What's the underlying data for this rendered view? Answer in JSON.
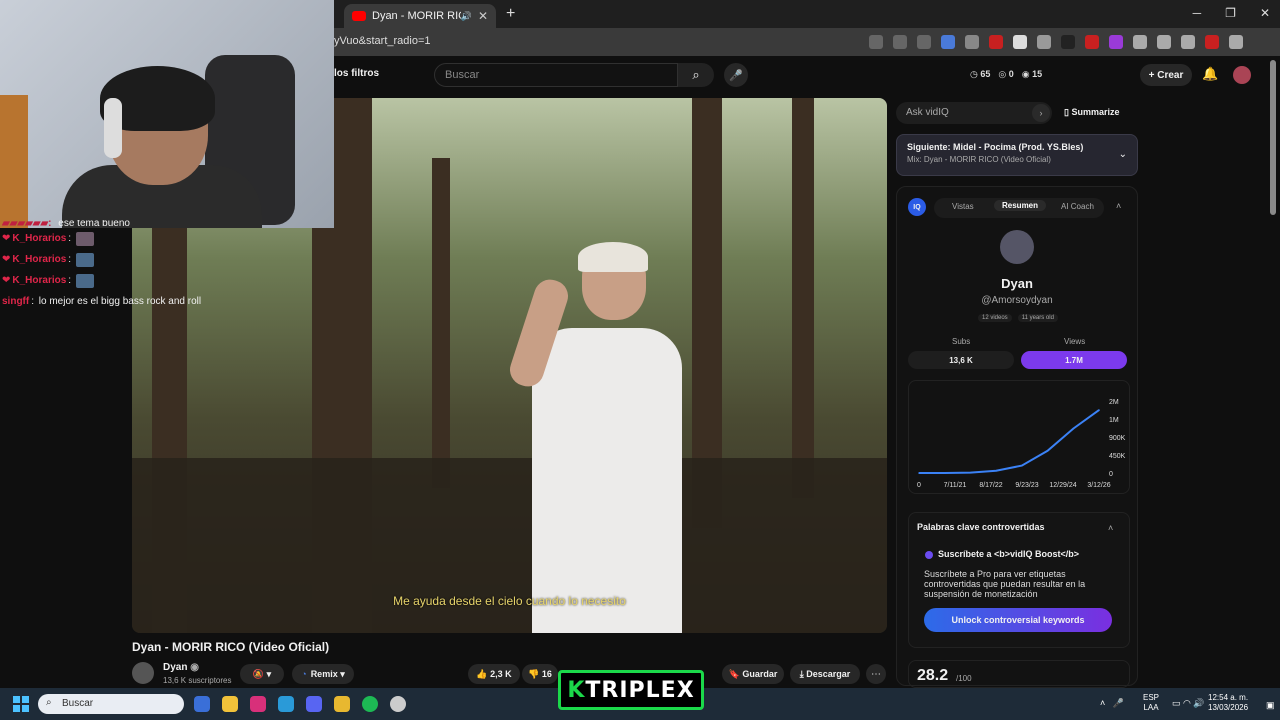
{
  "browser": {
    "tab_title": "Dyan - MORIR RICO (Vide",
    "url_fragment": "yVuo&start_radio=1"
  },
  "header": {
    "filters_label": "los filtros",
    "search_placeholder": "Buscar",
    "stat1": "65",
    "stat2": "0",
    "stat3": "15",
    "create_label": "Crear"
  },
  "chat": [
    {
      "user": "K_Horarios",
      "text": ""
    },
    {
      "user": "K_Horarios",
      "text": ""
    },
    {
      "user": "K_Horarios",
      "text": ""
    },
    {
      "user": "singff",
      "text": "lo mejor es el bigg bass rock and roll"
    }
  ],
  "chat_partial": "ese tema bueno",
  "video": {
    "subtitle": "Me ayuda desde el cielo cuando lo necesito",
    "title": "Dyan - MORIR RICO (Video Oficial)",
    "channel": "Dyan",
    "subs": "13,6 K suscriptores",
    "remix_label": "Remix",
    "likes": "2,3 K",
    "dislikes": "16",
    "save_label": "Guardar",
    "download_label": "Descargar"
  },
  "sidebar": {
    "ask_placeholder": "Ask vidIQ",
    "summarize_label": "Summarize",
    "next_label": "Siguiente: Midel - Pocima (Prod. YS.Bles)",
    "next_mix": "Mix: Dyan - MORIR RICO (Video Oficial)",
    "iq_badge": "IQ",
    "tabs": [
      "Vistas",
      "Resumen",
      "AI Coach"
    ],
    "channel_name": "Dyan",
    "handle": "@Amorsoydyan",
    "tag1": "12 videos",
    "tag2": "11 years old",
    "subs_label": "Subs",
    "views_label": "Views",
    "subs_value": "13,6 K",
    "views_value": "1.7M",
    "kw_title": "Palabras clave controvertidas",
    "kw_sub": "Suscríbete a <b>vidIQ Boost</b>",
    "kw_desc": "Suscríbete a Pro para ver etiquetas controvertidas que puedan resultar en la suspensión de monetización",
    "unlock_label": "Unlock controversial keywords",
    "score": "28.2",
    "score_max": "/100"
  },
  "chart_data": {
    "type": "line",
    "x_ticks": [
      "0",
      "7/11/21",
      "8/17/22",
      "9/23/23",
      "12/29/24",
      "3/12/26"
    ],
    "y_ticks": [
      "0",
      "450K",
      "900K",
      "1M",
      "2M"
    ],
    "x": [
      "7/11/21",
      "8/17/22",
      "9/23/23",
      "12/29/24",
      "6/1/25",
      "10/1/25",
      "1/1/26",
      "3/12/26"
    ],
    "values": [
      0,
      0,
      10000,
      60000,
      200000,
      600000,
      1200000,
      1700000
    ],
    "color": "#3b82f6"
  },
  "taskbar": {
    "search_label": "Buscar",
    "lang1": "ESP",
    "lang2": "LAA",
    "time": "12:54 a. m.",
    "date": "13/03/2026"
  },
  "logo_text": "TRIPLEX",
  "logo_k": "K"
}
